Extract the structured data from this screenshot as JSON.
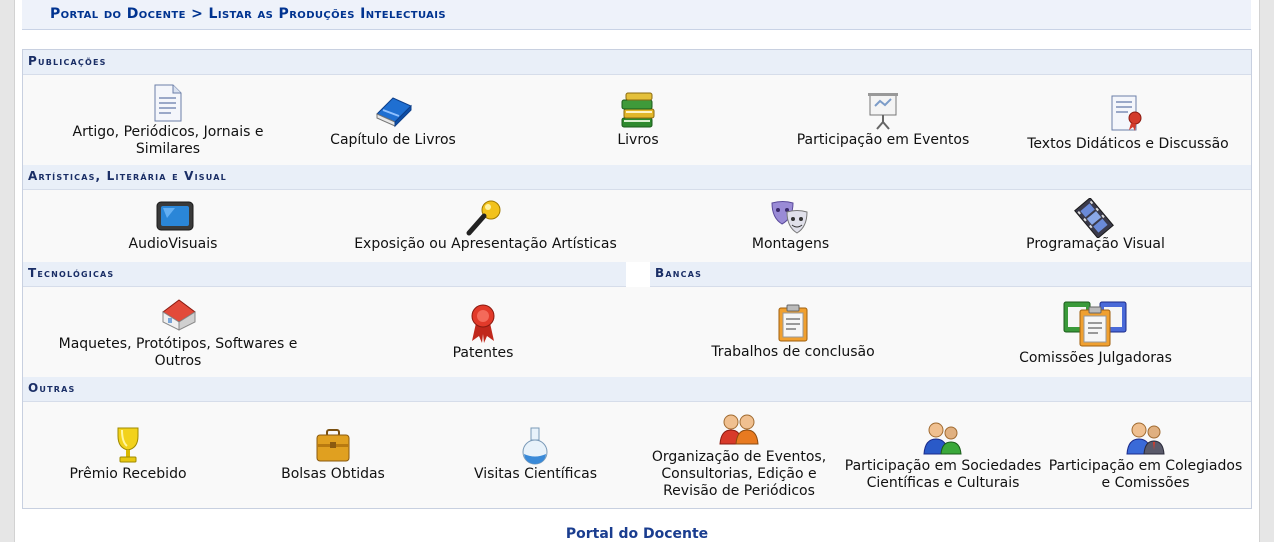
{
  "breadcrumb": "Portal do Docente > Listar as Produções Intelectuais",
  "sections": {
    "publicacoes": "Publicações",
    "artisticas": "Artísticas, Literária e Visual",
    "tecnologicas": "Tecnológicas",
    "bancas": "Bancas",
    "outras": "Outras"
  },
  "publicacoes": [
    {
      "label": "Artigo, Periódicos, Jornais e Similares",
      "icon": "document-icon"
    },
    {
      "label": "Capítulo de Livros",
      "icon": "blue-book-icon"
    },
    {
      "label": "Livros",
      "icon": "books-stack-icon"
    },
    {
      "label": "Participação em Eventos",
      "icon": "presentation-board-icon"
    },
    {
      "label": "Textos Didáticos e Discussão",
      "icon": "certificate-document-icon"
    }
  ],
  "artisticas": [
    {
      "label": "AudioVisuais",
      "icon": "tv-icon"
    },
    {
      "label": "Exposição ou Apresentação Artísticas",
      "icon": "microphone-icon"
    },
    {
      "label": "Montagens",
      "icon": "theater-masks-icon"
    },
    {
      "label": "Programação Visual",
      "icon": "film-reel-icon"
    }
  ],
  "tecnologicas": [
    {
      "label": "Maquetes, Protótipos, Softwares e Outros",
      "icon": "house-model-icon"
    },
    {
      "label": "Patentes",
      "icon": "ribbon-award-icon"
    }
  ],
  "bancas": [
    {
      "label": "Trabalhos de conclusão",
      "icon": "clipboard-icon"
    },
    {
      "label": "Comissões Julgadoras",
      "icon": "clipboards-group-icon"
    }
  ],
  "outras": [
    {
      "label": "Prêmio Recebido",
      "icon": "trophy-icon"
    },
    {
      "label": "Bolsas Obtidas",
      "icon": "briefcase-icon"
    },
    {
      "label": "Visitas Científicas",
      "icon": "flask-icon"
    },
    {
      "label": "Organização de Eventos, Consultorias, Edição e Revisão de Periódicos",
      "icon": "people-pair-icon"
    },
    {
      "label": "Participação em Sociedades Científicas e Culturais",
      "icon": "people-group-icon"
    },
    {
      "label": "Participação em Colegiados e Comissões",
      "icon": "people-meeting-icon"
    }
  ],
  "footer": "Portal do Docente"
}
